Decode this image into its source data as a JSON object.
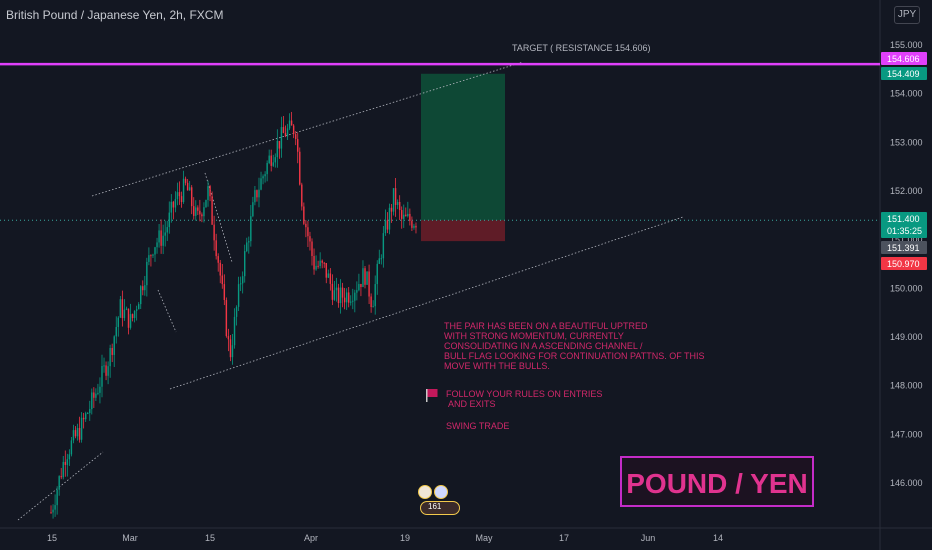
{
  "header": {
    "title": "British Pound / Japanese Yen, 2h, FXCM",
    "currency": "JPY"
  },
  "chart_data": {
    "type": "candlestick",
    "x_tick_labels": [
      "15",
      "Mar",
      "15",
      "Apr",
      "19",
      "May",
      "17",
      "Jun",
      "14"
    ],
    "y_ticks": [
      146.0,
      147.0,
      148.0,
      149.0,
      150.0,
      151.0,
      152.0,
      153.0,
      154.0,
      155.0
    ],
    "ylim": [
      145.3,
      155.1
    ],
    "grid": false,
    "price_labels": [
      {
        "value": "154.606",
        "color": "#e040fb"
      },
      {
        "value": "154.409",
        "color": "#089981"
      },
      {
        "value": "151.400",
        "color": "#089981",
        "sub": "01:35:25"
      },
      {
        "value": "151.391",
        "color": "#4c525e"
      },
      {
        "value": "150.970",
        "color": "#f23645"
      }
    ],
    "target_label": "TARGET ( RESISTANCE 154.606)",
    "target_price": 154.606,
    "position": {
      "entry": 151.4,
      "take_profit": 154.409,
      "stop_loss": 150.97
    },
    "path_points": [
      [
        0,
        145.4
      ],
      [
        0.04,
        146.6
      ],
      [
        0.08,
        147.1
      ],
      [
        0.12,
        147.8
      ],
      [
        0.16,
        148.6
      ],
      [
        0.19,
        149.6
      ],
      [
        0.22,
        149.3
      ],
      [
        0.25,
        150.1
      ],
      [
        0.28,
        150.9
      ],
      [
        0.31,
        151.1
      ],
      [
        0.34,
        151.8
      ],
      [
        0.37,
        152.1
      ],
      [
        0.4,
        151.4
      ],
      [
        0.43,
        152.0
      ],
      [
        0.46,
        150.5
      ],
      [
        0.49,
        148.6
      ],
      [
        0.52,
        150.2
      ],
      [
        0.56,
        151.9
      ],
      [
        0.6,
        152.7
      ],
      [
        0.64,
        153.2
      ],
      [
        0.67,
        153.3
      ],
      [
        0.69,
        151.6
      ],
      [
        0.72,
        150.5
      ],
      [
        0.75,
        150.4
      ],
      [
        0.78,
        149.8
      ],
      [
        0.82,
        149.9
      ],
      [
        0.86,
        150.3
      ],
      [
        0.88,
        149.7
      ],
      [
        0.91,
        151.0
      ],
      [
        0.94,
        151.9
      ],
      [
        0.96,
        151.4
      ]
    ]
  },
  "notes": {
    "analysis": "THE PAIR HAS BEEN ON A BEAUTIFUL UPTRED\nWITH STRONG MOMENTUM, CURRENTLY\nCONSOLIDATING IN A ASCENDING CHANNEL /\nBULL FLAG LOOKING FOR CONTINUATION PATTNS. OF THIS\nMOVE WITH THE BULLS.",
    "rules": "FOLLOW YOUR RULES ON ENTRIES\n AND EXITS",
    "style": "SWING TRADE"
  },
  "badge": "POUND / YEN",
  "boost_count": "161",
  "colors": {
    "up": "#089981",
    "down": "#f23645",
    "target_line": "#e040fb",
    "note_text": "#d1286a"
  }
}
